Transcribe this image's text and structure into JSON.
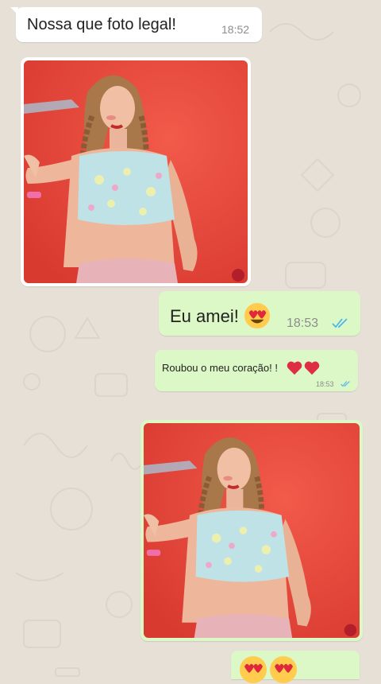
{
  "chat": {
    "messages": [
      {
        "text": "Nossa que foto legal!",
        "time": "18:52"
      },
      {
        "text": "Eu amei!",
        "time": "18:53"
      },
      {
        "text": "Roubou o meu coração! !",
        "time": "18:53"
      }
    ]
  },
  "icons": {
    "heart_eyes": "heart-eyes-emoji",
    "heart": "red-heart-emoji",
    "read_ticks": "double-check-icon"
  },
  "colors": {
    "incoming_bubble": "#ffffff",
    "outgoing_bubble": "#dcf8c6",
    "read_ticks": "#4fb6ec",
    "chat_background": "#e6e0d7"
  }
}
